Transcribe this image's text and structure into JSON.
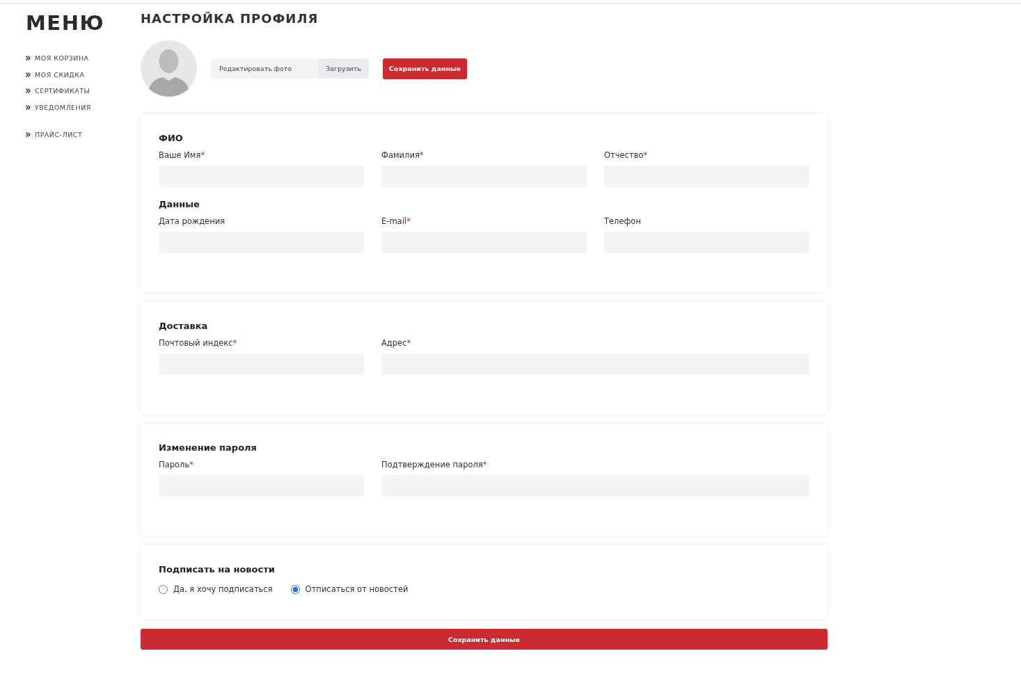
{
  "sidebar": {
    "title": "МЕНЮ",
    "groups": [
      {
        "items": [
          "МОЯ КОРЗИНА",
          "МОЯ СКИДКА",
          "СЕРТИФИКАТЫ",
          "УВЕДОМЛЕНИЯ"
        ]
      },
      {
        "items": [
          "ПРАЙС-ЛИСТ"
        ]
      }
    ]
  },
  "page_title": "НАСТРОЙКА ПРОФИЛЯ",
  "photo": {
    "field_label": "Редактировать фото",
    "upload_button": "Загрузить",
    "save_button": "Сохранить данные"
  },
  "cards": [
    {
      "sections": [
        {
          "title": "ФИО",
          "fields": [
            {
              "label": "Ваше Имя",
              "required_mark": "*",
              "kind": "normal"
            },
            {
              "label": "Фамилия",
              "required_mark": "*",
              "kind": "normal"
            },
            {
              "label": "Отчество",
              "required_mark": "*",
              "kind": "normal"
            }
          ]
        },
        {
          "title": "Данные",
          "fields": [
            {
              "label": "Дата рождения",
              "kind": "normal"
            },
            {
              "label": "E-mail",
              "required_mark": "*",
              "kind": "normal"
            },
            {
              "label": "Телефон",
              "kind": "normal"
            }
          ]
        }
      ]
    },
    {
      "sections": [
        {
          "title": "Доставка",
          "fields": [
            {
              "label": "Почтовый индекс",
              "required_mark": "*",
              "kind": "normal"
            },
            {
              "label": "Адрес",
              "required_mark": "*",
              "kind": "wide"
            }
          ]
        }
      ]
    },
    {
      "sections": [
        {
          "title": "Изменение пароля",
          "fields": [
            {
              "label": "Пароль",
              "required_mark": "*",
              "kind": "normal"
            },
            {
              "label": "Подтверждение пароля",
              "required_mark": "*",
              "kind": "wide"
            }
          ]
        }
      ]
    }
  ],
  "newsletter": {
    "title": "Подписать на новости",
    "options": [
      {
        "label": "Да, я хочу подписаться",
        "selected": false
      },
      {
        "label": "Отписаться от новостей",
        "selected": true
      }
    ]
  },
  "submit_button": "Сохранить данные"
}
